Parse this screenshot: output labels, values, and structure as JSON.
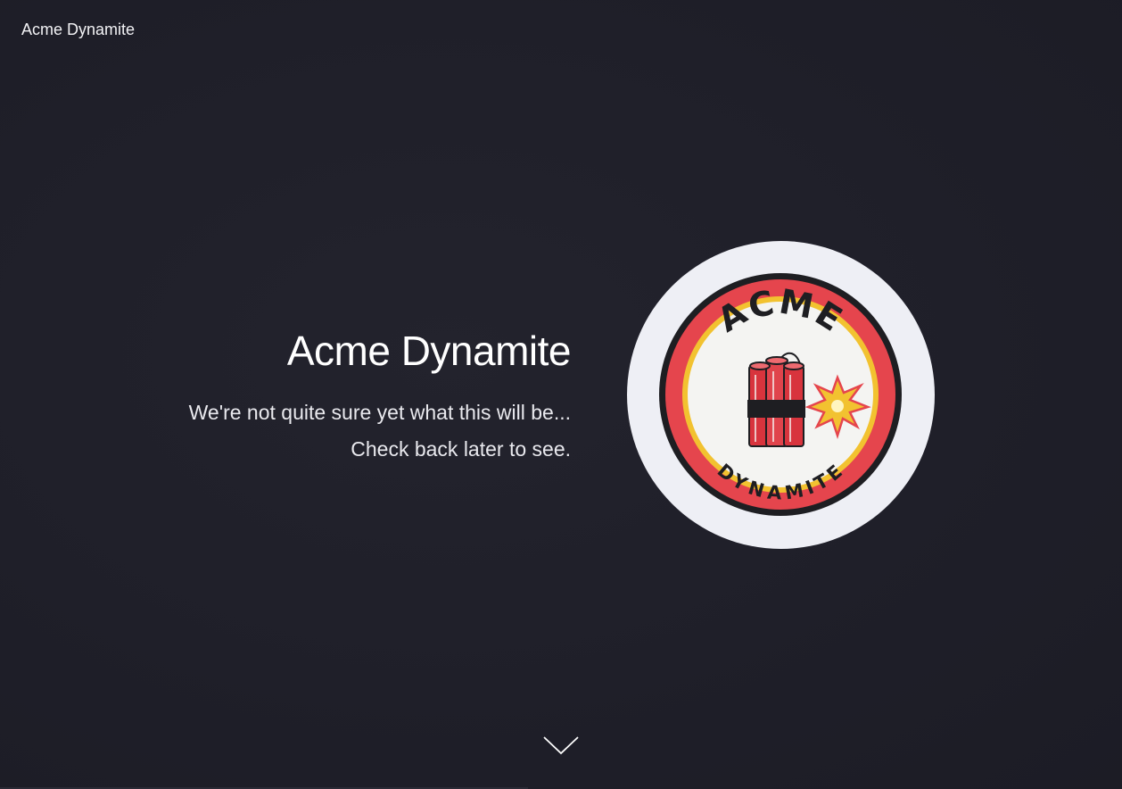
{
  "header": {
    "brand": "Acme Dynamite"
  },
  "hero": {
    "title": "Acme Dynamite",
    "line1": "We're not quite sure yet what this will be...",
    "line2": "Check back later to see."
  },
  "logo": {
    "top_text": "ACME",
    "bottom_text": "DYNAMITE"
  },
  "icons": {
    "scroll": "chevron-down-icon"
  },
  "colors": {
    "background": "#1f1f28",
    "logo_red": "#e5454d",
    "logo_yellow": "#f2c230",
    "logo_dark": "#1e1e22"
  }
}
